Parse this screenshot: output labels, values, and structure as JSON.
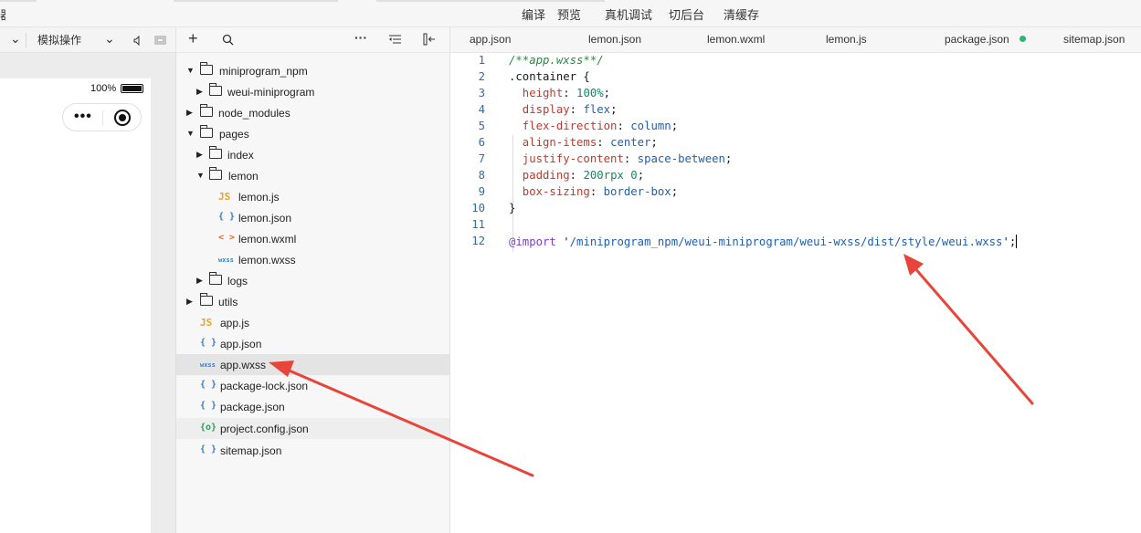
{
  "top_toolbar": {
    "edge_glyph": "器",
    "items": [
      "编译",
      "预览",
      "真机调试",
      "切后台",
      "清缓存"
    ]
  },
  "simulator": {
    "toolbar": {
      "dropdown_chevron": "⌄",
      "mode_label": "模拟操作",
      "mode_chevron": "⌄"
    },
    "status_battery_text": "100%"
  },
  "explorer": {
    "tree": [
      {
        "label": "miniprogram_npm",
        "type": "folder",
        "expanded": true
      },
      {
        "label": "weui-miniprogram",
        "type": "folder",
        "expanded": false
      },
      {
        "label": "node_modules",
        "type": "folder",
        "expanded": false
      },
      {
        "label": "pages",
        "type": "folder",
        "expanded": true
      },
      {
        "label": "index",
        "type": "folder",
        "expanded": false
      },
      {
        "label": "lemon",
        "type": "folder",
        "expanded": true
      },
      {
        "label": "lemon.js",
        "type": "js"
      },
      {
        "label": "lemon.json",
        "type": "json"
      },
      {
        "label": "lemon.wxml",
        "type": "wxml"
      },
      {
        "label": "lemon.wxss",
        "type": "wxss"
      },
      {
        "label": "logs",
        "type": "folder",
        "expanded": false
      },
      {
        "label": "utils",
        "type": "folder",
        "expanded": false
      },
      {
        "label": "app.js",
        "type": "js"
      },
      {
        "label": "app.json",
        "type": "json"
      },
      {
        "label": "app.wxss",
        "type": "wxss",
        "selected": true
      },
      {
        "label": "package-lock.json",
        "type": "json"
      },
      {
        "label": "package.json",
        "type": "json"
      },
      {
        "label": "project.config.json",
        "type": "config",
        "hover": true
      },
      {
        "label": "sitemap.json",
        "type": "json"
      }
    ],
    "icon_glyphs": {
      "js": "JS",
      "json": "{ }",
      "wxml": "< >",
      "wxss": "wxss",
      "config": "{o}"
    }
  },
  "editor": {
    "tabs": [
      {
        "label": "app.json"
      },
      {
        "label": "lemon.json"
      },
      {
        "label": "lemon.wxml"
      },
      {
        "label": "lemon.js"
      },
      {
        "label": "package.json",
        "modified": true
      },
      {
        "label": "sitemap.json"
      }
    ],
    "lines": [
      {
        "n": "1",
        "tokens": [
          {
            "t": "/**app.wxss**/",
            "c": "comment"
          }
        ]
      },
      {
        "n": "2",
        "tokens": [
          {
            "t": ".container {",
            "c": "default"
          }
        ]
      },
      {
        "n": "3",
        "tokens": [
          {
            "t": "  height",
            "c": "prop"
          },
          {
            "t": ": ",
            "c": "default"
          },
          {
            "t": "100%",
            "c": "number"
          },
          {
            "t": ";",
            "c": "default"
          }
        ]
      },
      {
        "n": "4",
        "tokens": [
          {
            "t": "  display",
            "c": "prop"
          },
          {
            "t": ": ",
            "c": "default"
          },
          {
            "t": "flex",
            "c": "value"
          },
          {
            "t": ";",
            "c": "default"
          }
        ]
      },
      {
        "n": "5",
        "tokens": [
          {
            "t": "  flex-direction",
            "c": "prop"
          },
          {
            "t": ": ",
            "c": "default"
          },
          {
            "t": "column",
            "c": "value"
          },
          {
            "t": ";",
            "c": "default"
          }
        ]
      },
      {
        "n": "6",
        "tokens": [
          {
            "t": "  align-items",
            "c": "prop"
          },
          {
            "t": ": ",
            "c": "default"
          },
          {
            "t": "center",
            "c": "value"
          },
          {
            "t": ";",
            "c": "default"
          }
        ]
      },
      {
        "n": "7",
        "tokens": [
          {
            "t": "  justify-content",
            "c": "prop"
          },
          {
            "t": ": ",
            "c": "default"
          },
          {
            "t": "space-between",
            "c": "value"
          },
          {
            "t": ";",
            "c": "default"
          }
        ]
      },
      {
        "n": "8",
        "tokens": [
          {
            "t": "  padding",
            "c": "prop"
          },
          {
            "t": ": ",
            "c": "default"
          },
          {
            "t": "200rpx 0",
            "c": "number"
          },
          {
            "t": ";",
            "c": "default"
          }
        ]
      },
      {
        "n": "9",
        "tokens": [
          {
            "t": "  box-sizing",
            "c": "prop"
          },
          {
            "t": ": ",
            "c": "default"
          },
          {
            "t": "border-box",
            "c": "value"
          },
          {
            "t": ";",
            "c": "default"
          }
        ]
      },
      {
        "n": "10",
        "tokens": [
          {
            "t": "}",
            "c": "default"
          }
        ]
      },
      {
        "n": "11",
        "tokens": []
      },
      {
        "n": "12",
        "tokens": [
          {
            "t": "@import",
            "c": "atrule"
          },
          {
            "t": " '",
            "c": "default"
          },
          {
            "t": "/miniprogram_npm/weui-miniprogram/weui-wxss/dist/style/weui.wxss",
            "c": "string"
          },
          {
            "t": "';",
            "c": "default"
          }
        ],
        "cursor": true
      }
    ]
  },
  "colors": {
    "annotation_arrow": "#e8443a",
    "modified_dot": "#2bb673",
    "line_number": "#2a6fb0"
  }
}
